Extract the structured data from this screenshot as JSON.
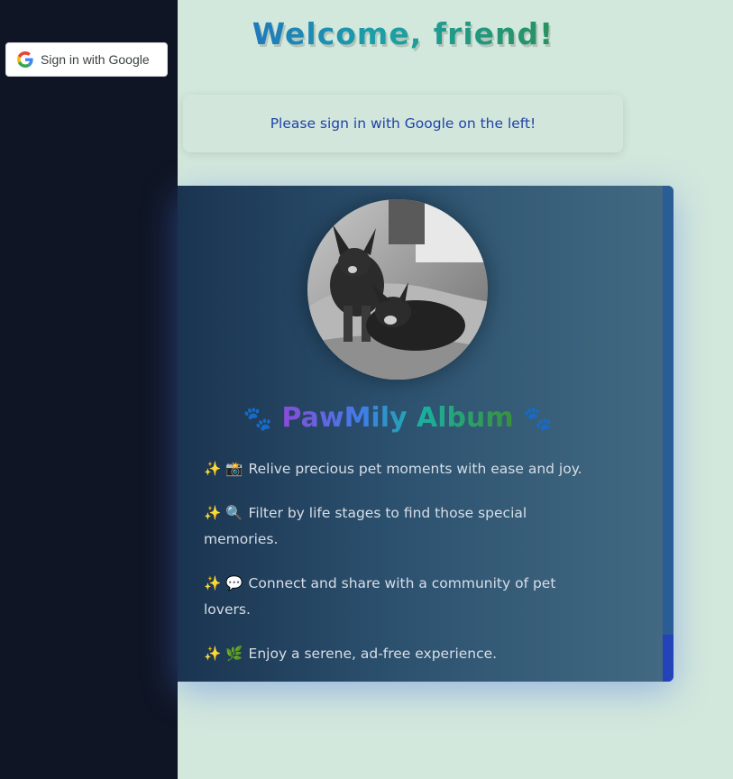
{
  "sidebar": {
    "google_button": {
      "label": "Sign in with Google",
      "icon": "google-g-icon"
    }
  },
  "header": {
    "title": "Welcome, friend!"
  },
  "notice": {
    "text": "Please sign in with Google on the left!"
  },
  "card": {
    "image": "dogs-photo",
    "title": "PawMily Album",
    "title_left_icon": "🐾",
    "title_right_icon": "🐾",
    "features": [
      {
        "icons": "✨ 📸",
        "text": "Relive precious pet moments with ease and joy."
      },
      {
        "icons": "✨ 🔍",
        "text": "Filter by life stages to find those special memories."
      },
      {
        "icons": "✨ 💬",
        "text": "Connect and share with a community of pet lovers."
      },
      {
        "icons": "✨ 🌿",
        "text": "Enjoy a serene, ad-free experience."
      }
    ]
  },
  "colors": {
    "sidebar_bg": "#0f1524",
    "page_bg": "#d3e8dc",
    "notice_text": "#1e44a8",
    "card_bg_start": "#1a3450",
    "card_bg_end": "#436a82"
  }
}
